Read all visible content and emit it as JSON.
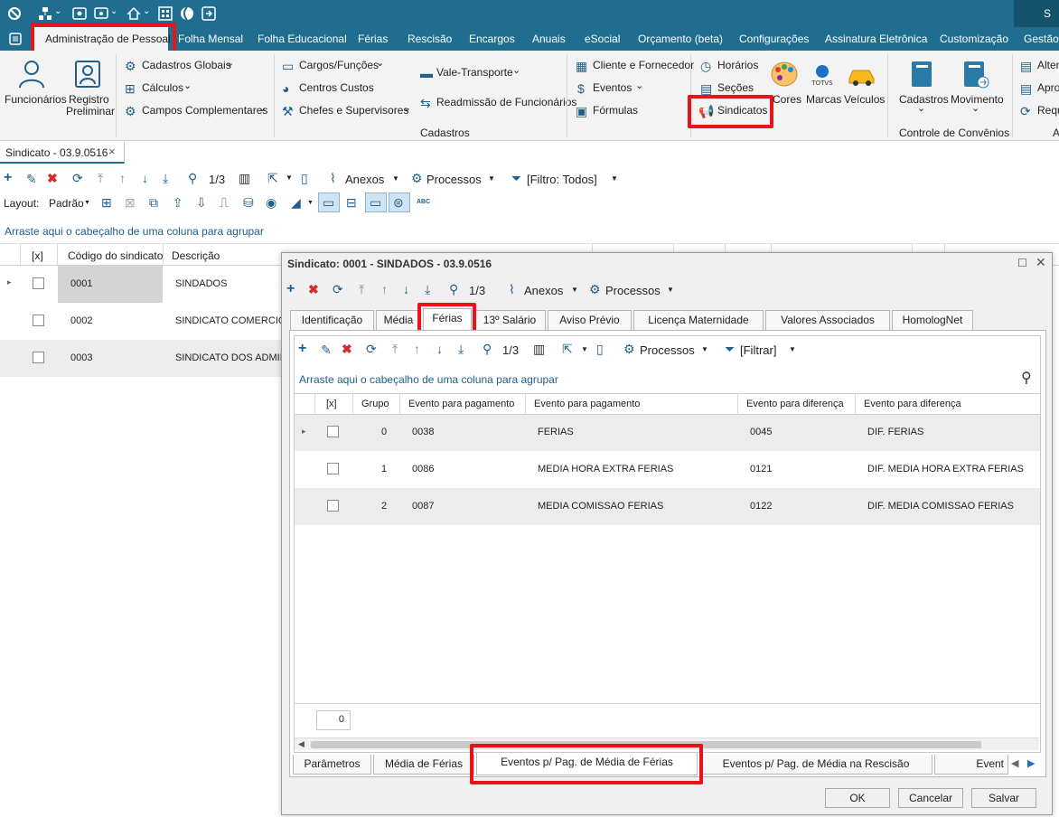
{
  "menu": {
    "items": [
      "Administração de Pessoal",
      "Folha Mensal",
      "Folha Educacional",
      "Férias",
      "Rescisão",
      "Encargos",
      "Anuais",
      "eSocial",
      "Orçamento (beta)",
      "Configurações",
      "Assinatura Eletrônica",
      "Customização",
      "Gestão"
    ],
    "corner": "S"
  },
  "ribbon": {
    "funcionarios": "Funcionários",
    "registro": "Registro",
    "preliminar": "Preliminar",
    "cadastros_globais": "Cadastros Globais",
    "calculos": "Cálculos",
    "campos_complementares": "Campos Complementares",
    "cargos": "Cargos/Funções",
    "centros_custos": "Centros Custos",
    "chefes": "Chefes e Supervisores",
    "vale_transporte": "Vale-Transporte",
    "readmissao": "Readmissão de Funcionários",
    "cliente_fornecedor": "Cliente e Fornecedor",
    "eventos": "Eventos",
    "formulas": "Fórmulas",
    "horarios": "Horários",
    "secoes": "Seções",
    "sindicatos": "Sindicatos",
    "cores": "Cores",
    "marcas": "Marcas",
    "veiculos": "Veículos",
    "cadastros_group": "Cadastros",
    "cadastros_btn": "Cadastros",
    "movimento_btn": "Movimento",
    "controle_convenios": "Controle de Convênios",
    "alter": "Alter",
    "apro": "Apro",
    "requ": "Requ",
    "a": "A",
    "totvs": "TOTVS"
  },
  "doc_tab": {
    "label": "Sindicato - 03.9.0516",
    "close": "×"
  },
  "main_toolbar": {
    "page": "1/3",
    "anexos": "Anexos",
    "processos": "Processos",
    "filtro": "[Filtro: Todos]",
    "layout": "Layout:",
    "padrao": "Padrão",
    "abc": "ABC"
  },
  "main_group_hint": "Arraste aqui o cabeçalho de uma coluna para agrupar",
  "main_table": {
    "headers": [
      "[x]",
      "Código do sindicato",
      "Descrição"
    ],
    "rows": [
      {
        "codigo": "0001",
        "descricao": "SINDADOS"
      },
      {
        "codigo": "0002",
        "descricao": "SINDICATO COMERCIO"
      },
      {
        "codigo": "0003",
        "descricao": "SINDICATO DOS ADMIN"
      }
    ]
  },
  "dialog": {
    "title": "Sindicato: 0001 - SINDADOS - 03.9.0516",
    "page": "1/3",
    "anexos": "Anexos",
    "processos": "Processos",
    "tabs": [
      "Identificação",
      "Média",
      "Férias",
      "13º Salário",
      "Aviso Prévio",
      "Licença Maternidade",
      "Valores Associados",
      "HomologNet"
    ],
    "inner_toolbar": {
      "page": "1/3",
      "processos": "Processos",
      "filtrar": "[Filtrar]"
    },
    "group_hint": "Arraste aqui o cabeçalho de uma coluna para agrupar",
    "table": {
      "headers": [
        "[x]",
        "Grupo",
        "Evento para pagamento",
        "Evento para pagamento",
        "Evento para diferença",
        "Evento para diferença"
      ],
      "rows": [
        {
          "grupo": "0",
          "ev_pag": "0038",
          "ev_pag_desc": "FERIAS",
          "ev_dif": "0045",
          "ev_dif_desc": "DIF. FERIAS"
        },
        {
          "grupo": "1",
          "ev_pag": "0086",
          "ev_pag_desc": "MEDIA HORA EXTRA FERIAS",
          "ev_dif": "0121",
          "ev_dif_desc": "DIF. MEDIA HORA EXTRA FERIAS"
        },
        {
          "grupo": "2",
          "ev_pag": "0087",
          "ev_pag_desc": "MEDIA COMISSAO FERIAS",
          "ev_dif": "0122",
          "ev_dif_desc": "DIF. MEDIA COMISSAO FERIAS"
        }
      ],
      "footer_count": "0"
    },
    "bottom_tabs": [
      "Parâmetros",
      "Média de Férias",
      "Eventos p/ Pag. de Média de Férias",
      "Eventos p/ Pag. de Média na Rescisão",
      "Event"
    ],
    "buttons": {
      "ok": "OK",
      "cancel": "Cancelar",
      "save": "Salvar"
    }
  }
}
